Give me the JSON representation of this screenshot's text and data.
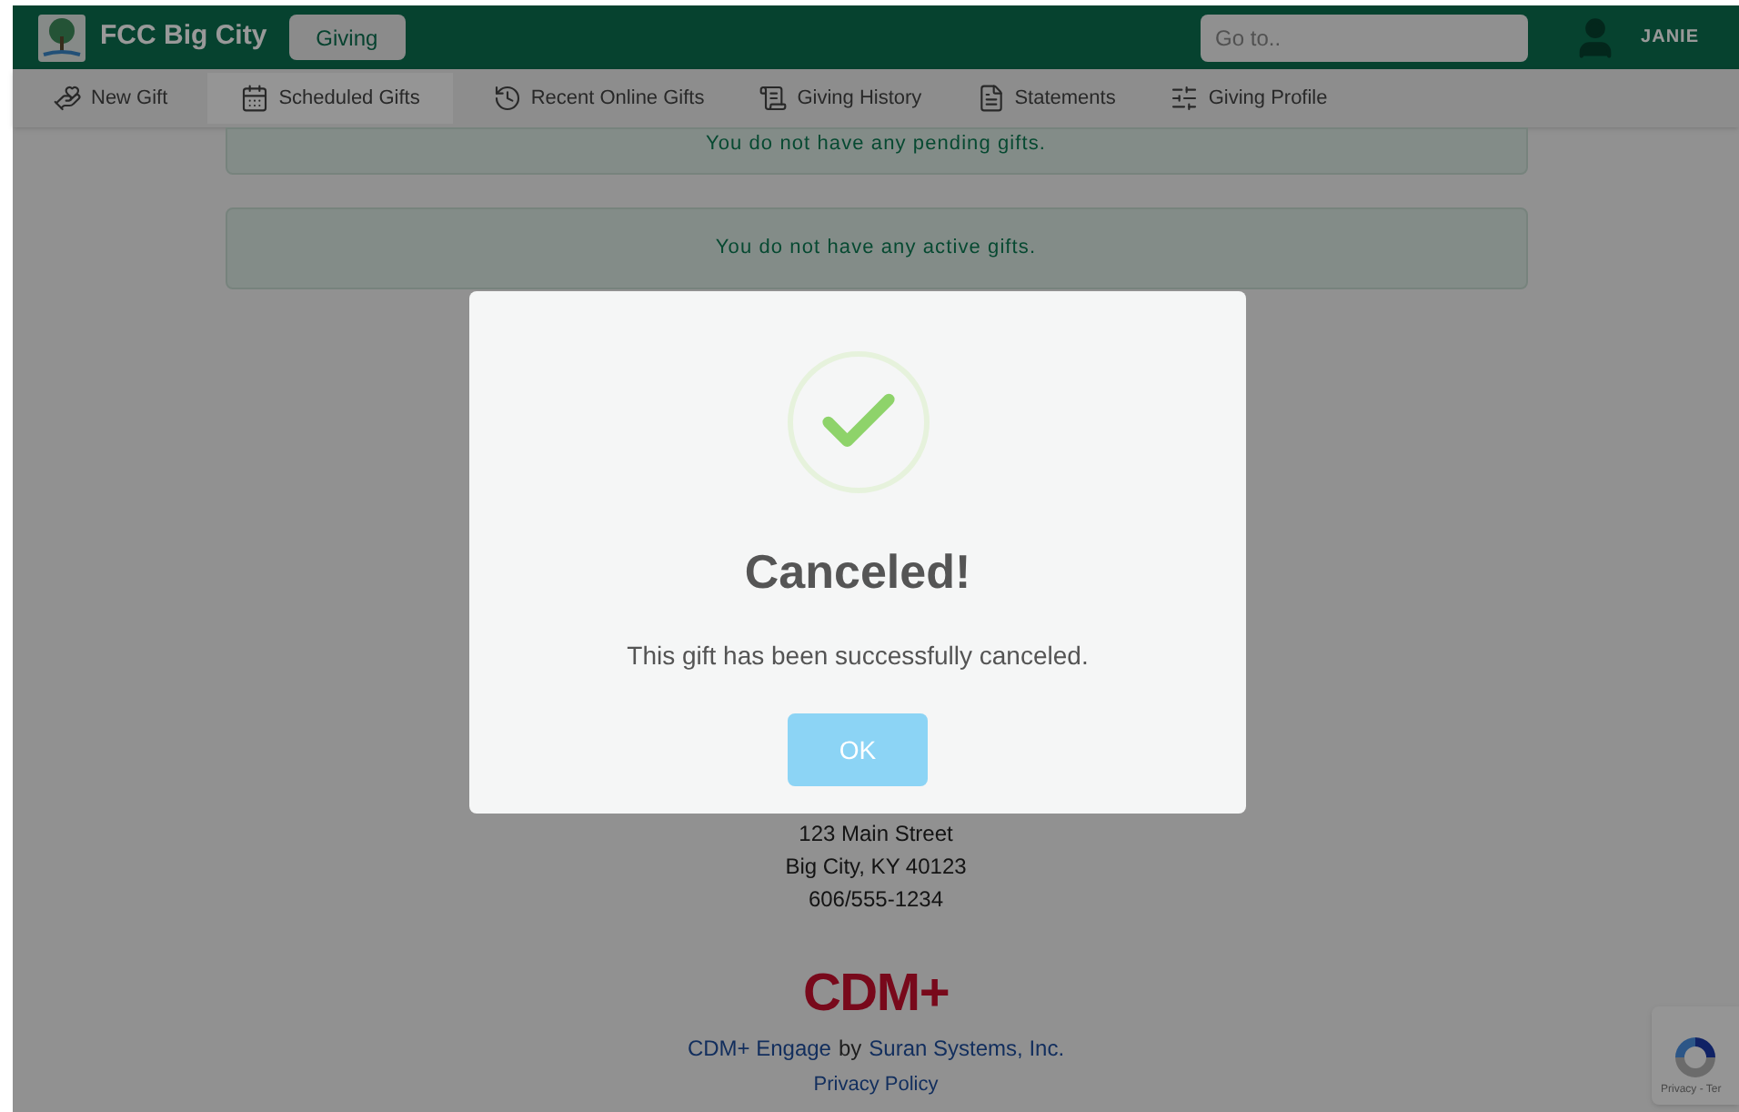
{
  "header": {
    "logo_text": "FCC Big City",
    "section_button": "Giving",
    "search": {
      "placeholder": "Go to.."
    },
    "user": "JANIE"
  },
  "nav": [
    {
      "label": "New Gift",
      "kind": "gift",
      "selected": false
    },
    {
      "label": "Scheduled Gifts",
      "kind": "calendar",
      "selected": true
    },
    {
      "label": "Recent Online Gifts",
      "kind": "history",
      "selected": false
    },
    {
      "label": "Giving History",
      "kind": "receipt",
      "selected": false
    },
    {
      "label": "Statements",
      "kind": "document",
      "selected": false
    },
    {
      "label": "Giving Profile",
      "kind": "sliders",
      "selected": false
    }
  ],
  "notices": [
    "You do not have any pending gifts.",
    "You do not have any active gifts."
  ],
  "modal": {
    "title": "Canceled!",
    "message": "This gift has been successfully canceled.",
    "button": "OK"
  },
  "footer": {
    "address_lines": [
      "123 Main Street",
      "Big City, KY 40123",
      "606/555-1234"
    ],
    "logo": "CDM+",
    "product_link": "CDM+ Engage",
    "by": "by",
    "company_link": "Suran Systems, Inc.",
    "privacy_link": "Privacy Policy"
  },
  "recaptcha": {
    "text": "Privacy - Ter"
  }
}
